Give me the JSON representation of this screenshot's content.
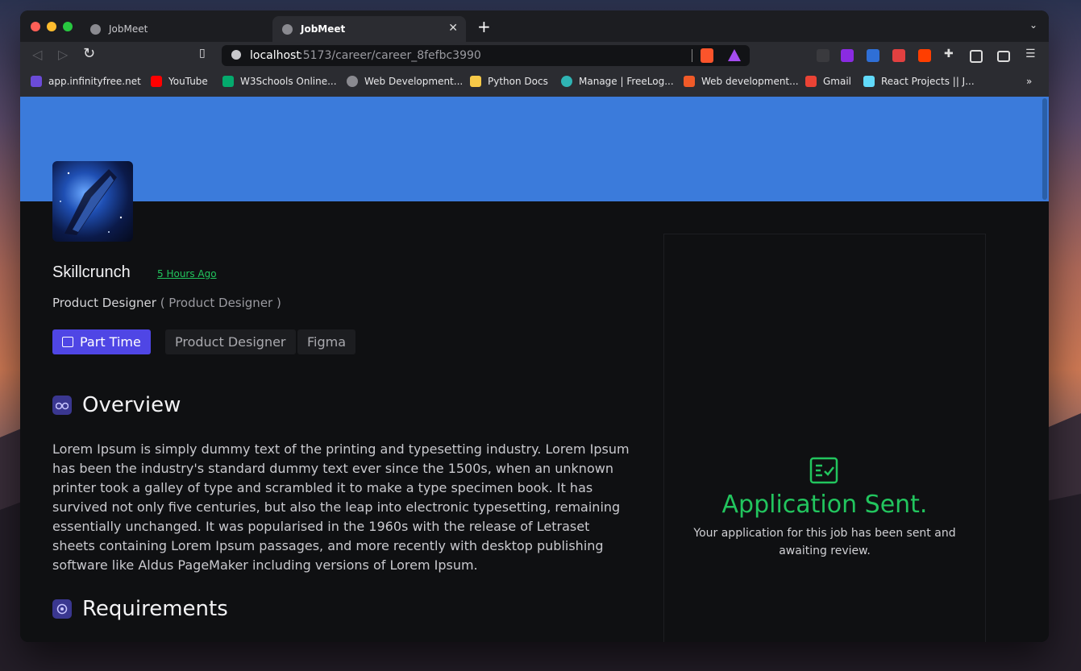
{
  "browser": {
    "tabs": [
      {
        "title": "JobMeet",
        "active": false
      },
      {
        "title": "JobMeet",
        "active": true
      }
    ],
    "url": {
      "host": "localhost",
      "rest": ":5173/career/career_8fefbc3990"
    },
    "bookmarks": [
      {
        "label": "app.infinityfree.net",
        "color": "#6b4bd8"
      },
      {
        "label": "YouTube",
        "color": "#ff0000"
      },
      {
        "label": "W3Schools Online...",
        "color": "#04aa6d"
      },
      {
        "label": "Web Development...",
        "color": "#8a8a90"
      },
      {
        "label": "Python Docs",
        "color": "#f7c948"
      },
      {
        "label": "Manage | FreeLog...",
        "color": "#2fb4b4"
      },
      {
        "label": "Web development...",
        "color": "#f05a28"
      },
      {
        "label": "Gmail",
        "color": "#ea4335"
      },
      {
        "label": "React Projects || J...",
        "color": "#61dafb"
      }
    ]
  },
  "job": {
    "company": "Skillcrunch",
    "posted": "5 Hours Ago",
    "title": "Product Designer",
    "title_paren": "( Product Designer )",
    "type": "Part Time",
    "tags": [
      "Product Designer",
      "Figma"
    ]
  },
  "overview": {
    "heading": "Overview",
    "body": "Lorem Ipsum is simply dummy text of the printing and typesetting industry. Lorem Ipsum has been the industry's standard dummy text ever since the 1500s, when an unknown printer took a galley of type and scrambled it to make a type specimen book. It has survived not only five centuries, but also the leap into electronic typesetting, remaining essentially unchanged. It was popularised in the 1960s with the release of Letraset sheets containing Lorem Ipsum passages, and more recently with desktop publishing software like Aldus PageMaker including versions of Lorem Ipsum."
  },
  "requirements": {
    "heading": "Requirements"
  },
  "application": {
    "title": "Application Sent.",
    "message": "Your application for this job has been sent and awaiting review."
  },
  "colors": {
    "banner": "#3b7bdb",
    "accent_green": "#22c55e",
    "accent_purple": "#4f46e5"
  }
}
